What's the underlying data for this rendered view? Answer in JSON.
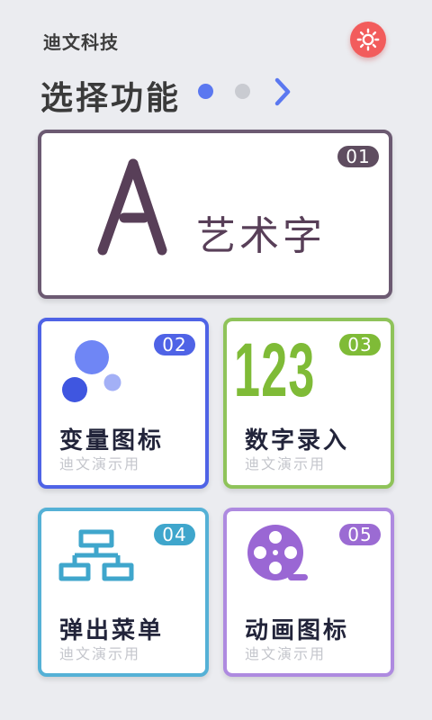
{
  "header": {
    "brand": "迪文科技",
    "title": "选择功能",
    "icons": {
      "settings": "sun-gear-icon",
      "next": "chevron-right-icon"
    },
    "pagination": {
      "current": 1,
      "total": 2
    }
  },
  "colors": {
    "background": "#ebecf0",
    "settings_button": "#f25c5c",
    "pagination_active": "#5b78f0",
    "pagination_inactive": "#c9cbd1"
  },
  "cards": [
    {
      "id": "01",
      "label": "艺术字",
      "icon": "letter-a-icon",
      "color": "#6c5a72"
    },
    {
      "id": "02",
      "label": "变量图标",
      "sublabel": "迪文演示用",
      "icon": "bubbles-icon",
      "color": "#4f63e6"
    },
    {
      "id": "03",
      "label": "数字录入",
      "sublabel": "迪文演示用",
      "icon": "digits-123-icon",
      "icon_text": "123",
      "color": "#7fbb37"
    },
    {
      "id": "04",
      "label": "弹出菜单",
      "sublabel": "迪文演示用",
      "icon": "hierarchy-icon",
      "color": "#3fa6cc"
    },
    {
      "id": "05",
      "label": "动画图标",
      "sublabel": "迪文演示用",
      "icon": "film-reel-icon",
      "color": "#9b6bd3"
    }
  ]
}
